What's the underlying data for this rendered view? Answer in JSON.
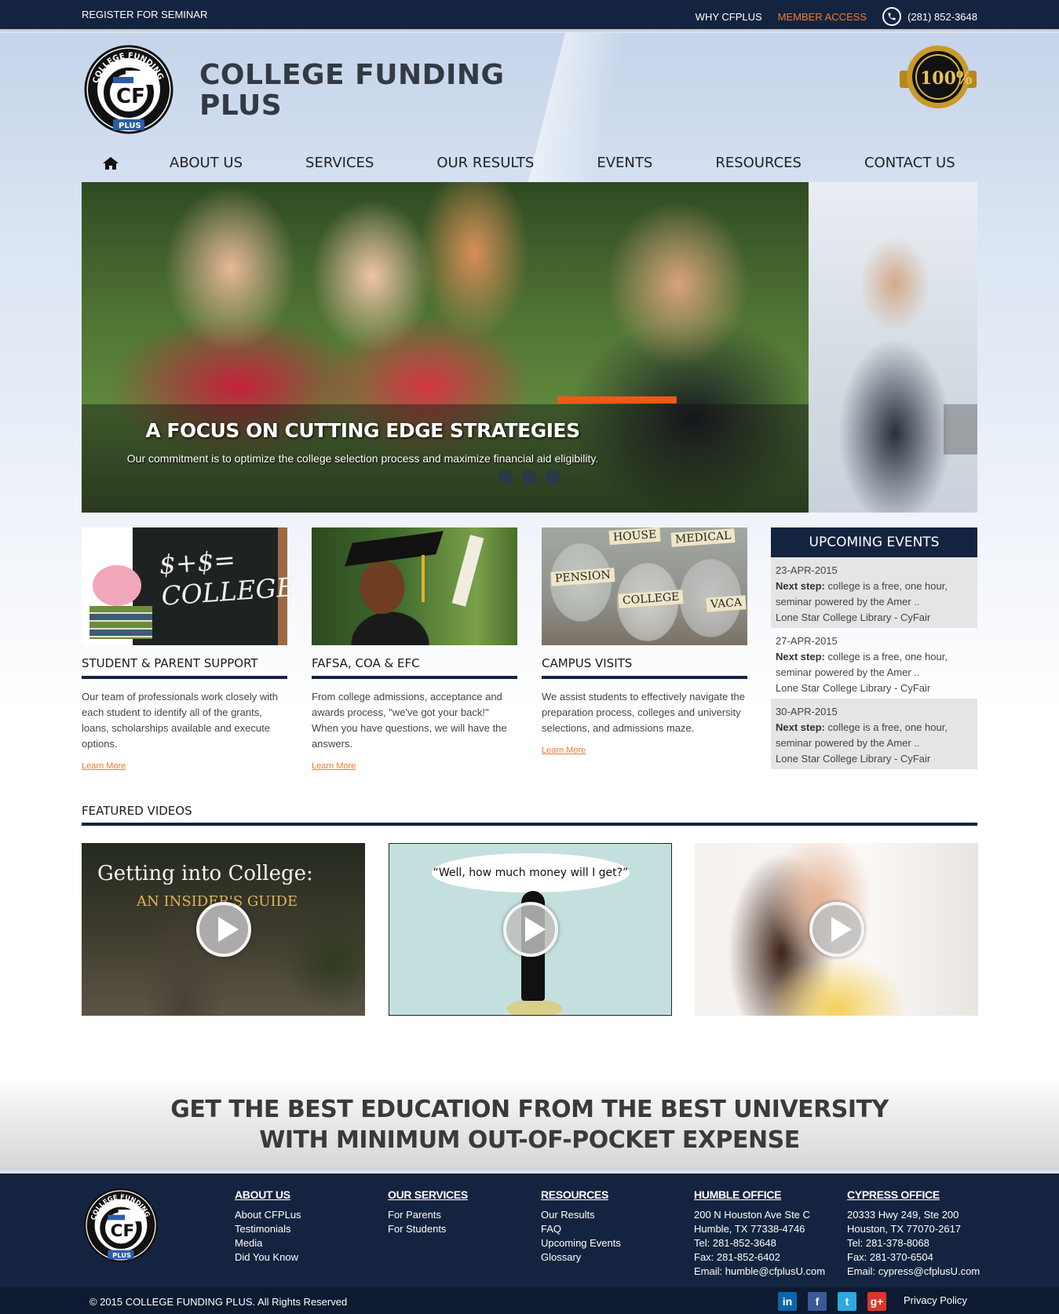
{
  "topbar": {
    "register": "REGISTER FOR SEMINAR",
    "why": "WHY CFPLUS",
    "member": "MEMBER ACCESS",
    "phone": "(281) 852-3648"
  },
  "brand": {
    "line1": "COLLEGE FUNDING",
    "line2": "PLUS",
    "logo_arc": "COLLEGE FUNDING",
    "logo_mark": "CF",
    "logo_sub": "PLUS",
    "seal_text": "100%"
  },
  "nav": {
    "items": [
      "ABOUT US",
      "SERVICES",
      "OUR RESULTS",
      "EVENTS",
      "RESOURCES",
      "CONTACT US"
    ]
  },
  "slider": {
    "title": "A FOCUS ON CUTTING EDGE STRATEGIES",
    "subtitle": "Our commitment is to optimize the college selection process and maximize financial aid eligibility."
  },
  "features": [
    {
      "title": "STUDENT & PARENT SUPPORT",
      "text": "Our team of professionals work closely with each student to identify all of the grants, loans, scholarships available and execute options.",
      "link": "Learn More",
      "image_text": "$+$= COLLEGE"
    },
    {
      "title": "FAFSA, COA & EFC",
      "text": "From college admissions, acceptance and awards process, \"we've got your back!\" When you have questions, we will have the answers.",
      "link": "Learn More"
    },
    {
      "title": "CAMPUS VISITS",
      "text": "We assist students to effectively navigate the preparation process, colleges and university selections, and admissions maze.",
      "link": "Learn More",
      "jar_labels": [
        "HOUSE",
        "MEDICAL",
        "PENSION",
        "COLLEGE",
        "VACA"
      ]
    }
  ],
  "events": {
    "title": "UPCOMING EVENTS",
    "items": [
      {
        "date": "23-APR-2015",
        "lead": "Next step:",
        "text": "college is a free, one hour, seminar powered by the Amer ..",
        "location": "Lone Star College Library - CyFair"
      },
      {
        "date": "27-APR-2015",
        "lead": "Next step:",
        "text": "college is a free, one hour, seminar powered by the Amer ..",
        "location": "Lone Star College Library - CyFair"
      },
      {
        "date": "30-APR-2015",
        "lead": "Next step:",
        "text": "college is a free, one hour, seminar powered by the Amer ..",
        "location": "Lone Star College Library - CyFair"
      }
    ]
  },
  "videos": {
    "title": "FEATURED VIDEOS",
    "v1_line1": "Getting into College:",
    "v1_line2": "AN INSIDER'S GUIDE",
    "v2_bubble": "“Well, how much money will I get?”"
  },
  "banner": {
    "line1": "GET THE BEST EDUCATION FROM THE BEST UNIVERSITY",
    "line2": "WITH MINIMUM OUT-OF-POCKET EXPENSE"
  },
  "footer": {
    "about": {
      "title": "ABOUT US",
      "links": [
        "About CFPLus",
        "Testimonials",
        "Media",
        "Did You Know"
      ]
    },
    "services": {
      "title": "OUR SERVICES",
      "links": [
        "For Parents",
        "For Students"
      ]
    },
    "resources": {
      "title": "RESOURCES",
      "links": [
        "Our Results",
        "FAQ",
        "Upcoming Events",
        "Glossary"
      ]
    },
    "humble": {
      "title": "HUMBLE OFFICE",
      "lines": [
        "200 N Houston Ave Ste C",
        "Humble, TX 77338-4746",
        "Tel: 281-852-3648",
        "Fax: 281-852-6402",
        "Email: humble@cfplusU.com"
      ]
    },
    "cypress": {
      "title": "CYPRESS OFFICE",
      "lines": [
        "20333 Hwy 249, Ste 200",
        "Houston, TX 77070-2617",
        "Tel: 281-378-8068",
        "Fax: 281-370-6504",
        "Email: cypress@cfplusU.com"
      ]
    },
    "copyright": "© 2015 COLLEGE FUNDING PLUS. All Rights Reserved",
    "privacy": "Privacy Policy",
    "social": {
      "linkedin": "in",
      "facebook": "f",
      "twitter": "t",
      "google": "g+"
    }
  },
  "colors": {
    "navy": "#14233f",
    "orange": "#f07a2b",
    "slider_bar": "#f05a14"
  }
}
